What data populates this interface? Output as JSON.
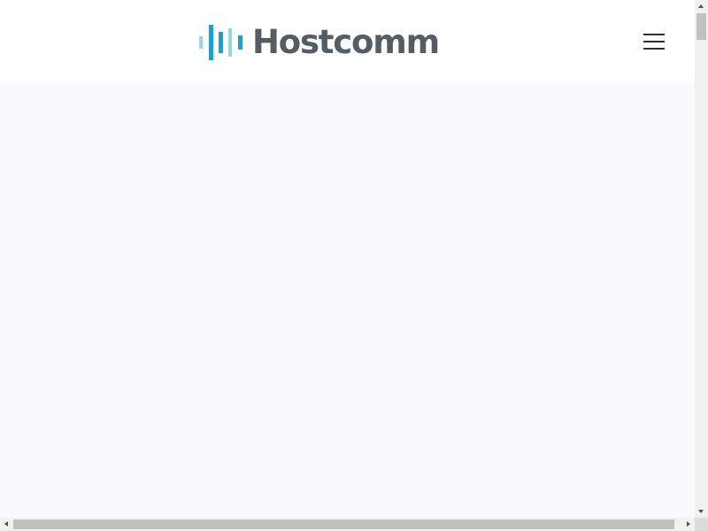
{
  "header": {
    "logo": {
      "text": "Hostcomm",
      "icon": "hostcomm-bars-logo-icon",
      "text_color": "#545d64",
      "mark_colors": [
        "#93d5ea",
        "#1a9fd6"
      ]
    },
    "menu_button": {
      "icon": "hamburger-menu-icon"
    }
  },
  "colors": {
    "header_background": "#ffffff",
    "page_background": "#f9fafd"
  },
  "scrollbars": {
    "vertical": {
      "position_fraction": 0.0
    },
    "horizontal": {
      "position_fraction": 0.0
    }
  }
}
